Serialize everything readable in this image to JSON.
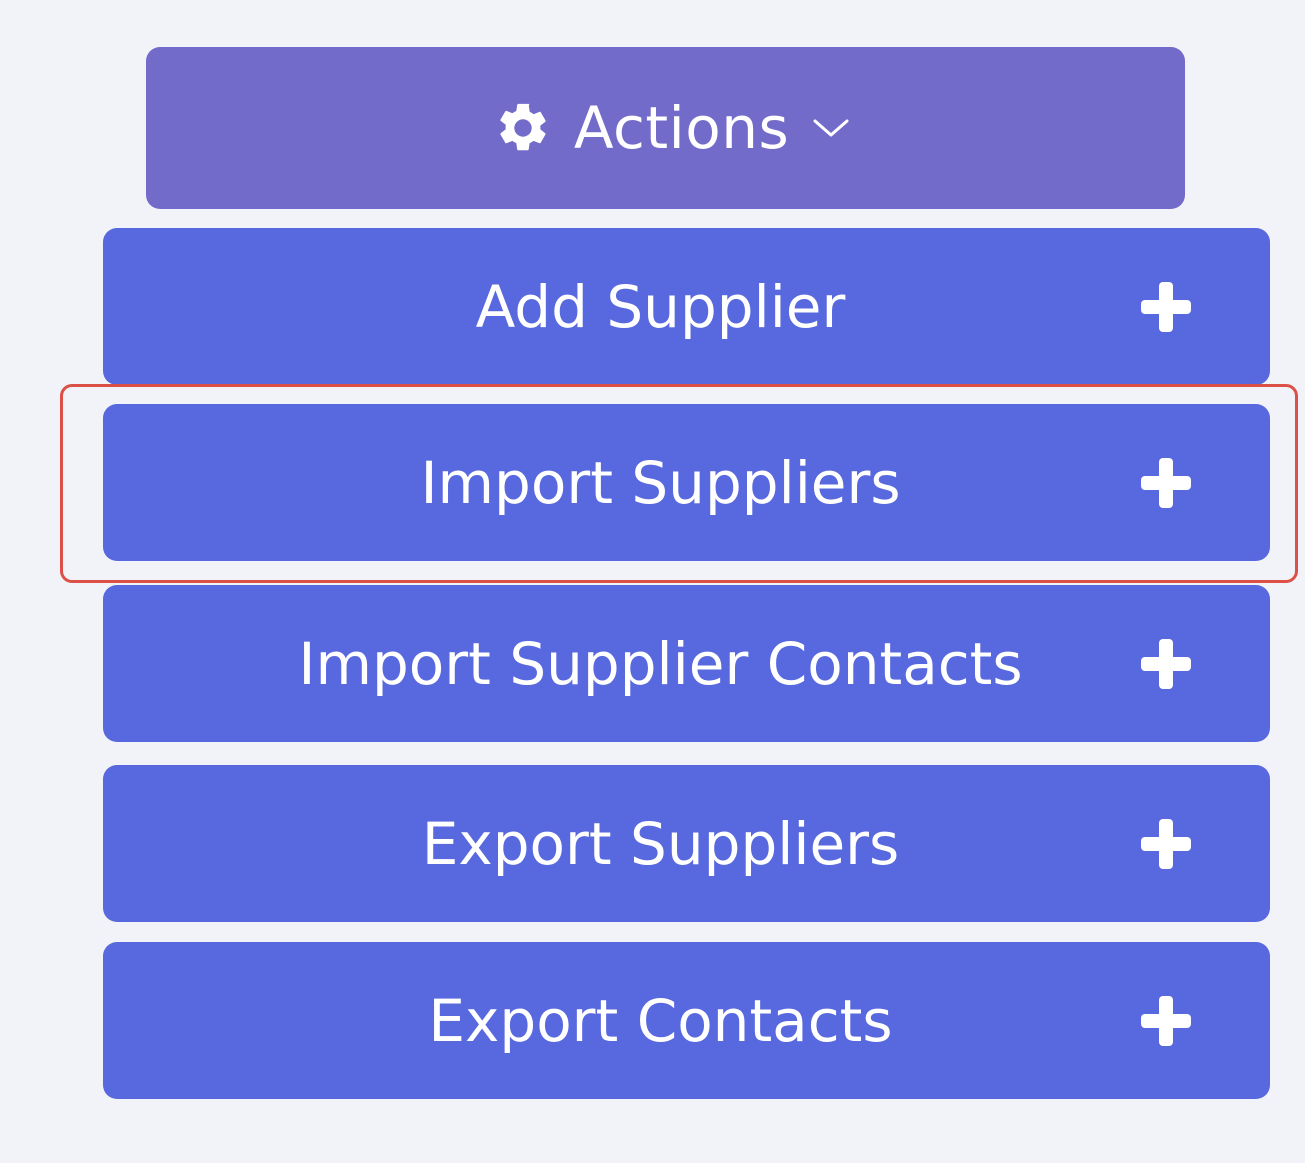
{
  "actions": {
    "label": "Actions",
    "icon": "gear-icon",
    "caret_icon": "chevron-down-icon"
  },
  "colors": {
    "background": "#f2f3f8",
    "actions_button": "#736bc9",
    "menu_item": "#5868df",
    "highlight": "#dc5048",
    "text": "#ffffff"
  },
  "menu": {
    "items": [
      {
        "label": "Add Supplier",
        "icon": "plus-icon"
      },
      {
        "label": "Import Suppliers",
        "icon": "plus-icon",
        "highlighted": true
      },
      {
        "label": "Import Supplier Contacts",
        "icon": "plus-icon"
      },
      {
        "label": "Export Suppliers",
        "icon": "plus-icon"
      },
      {
        "label": "Export Contacts",
        "icon": "plus-icon"
      }
    ]
  }
}
